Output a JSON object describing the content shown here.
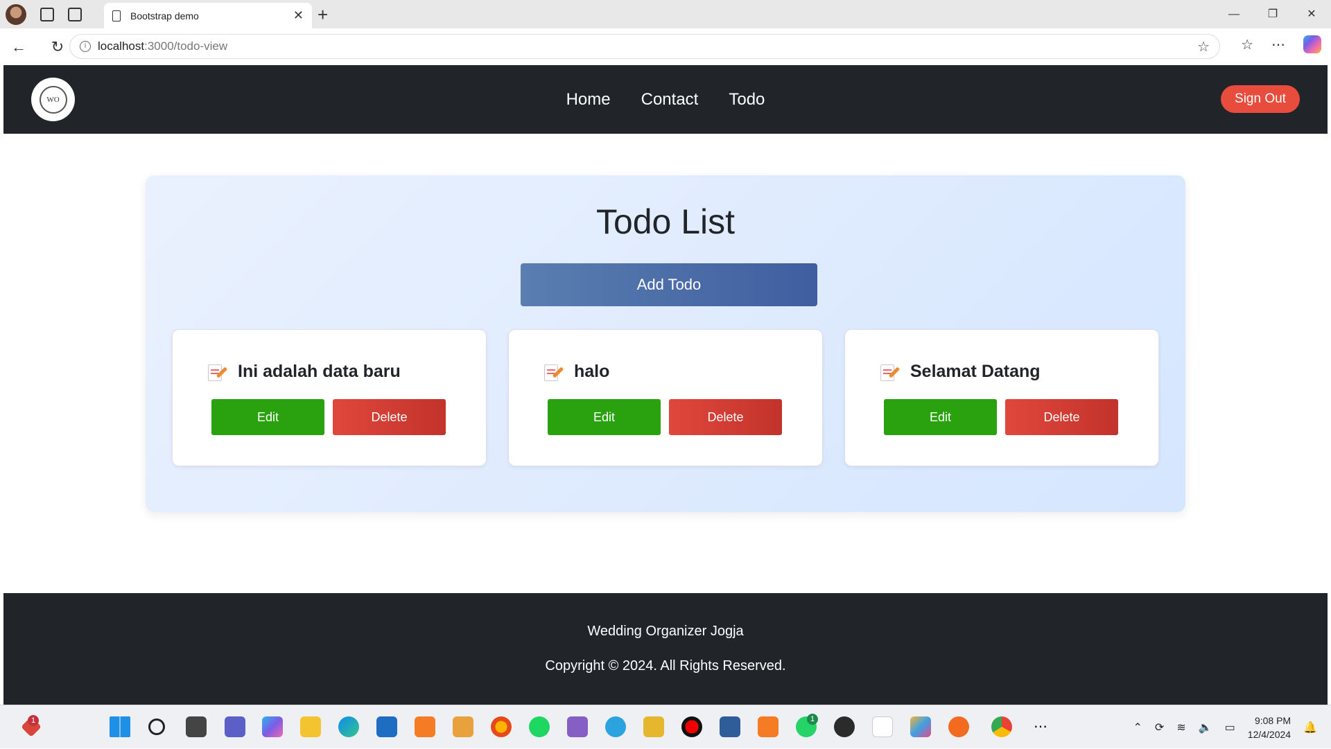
{
  "browser": {
    "tab_title": "Bootstrap demo",
    "url_host": "localhost",
    "url_path": ":3000/todo-view"
  },
  "navbar": {
    "logo_text": "WO",
    "links": [
      "Home",
      "Contact",
      "Todo"
    ],
    "signout_label": "Sign Out"
  },
  "main": {
    "title": "Todo List",
    "add_label": "Add Todo",
    "todos": [
      {
        "text": "Ini adalah data baru",
        "edit_label": "Edit",
        "delete_label": "Delete"
      },
      {
        "text": "halo",
        "edit_label": "Edit",
        "delete_label": "Delete"
      },
      {
        "text": "Selamat Datang",
        "edit_label": "Edit",
        "delete_label": "Delete"
      }
    ]
  },
  "footer": {
    "org": "Wedding Organizer Jogja",
    "copyright": "Copyright © 2024. All Rights Reserved."
  },
  "taskbar": {
    "time": "9:08 PM",
    "date": "12/4/2024",
    "badge_left": "1",
    "badge_whatsapp": "1"
  },
  "colors": {
    "navbar_bg": "#212529",
    "signout_bg": "#e74c3c",
    "edit_bg": "#2aa10f",
    "delete_bg": "#d13e34",
    "add_bg": "#4a6ba8"
  }
}
